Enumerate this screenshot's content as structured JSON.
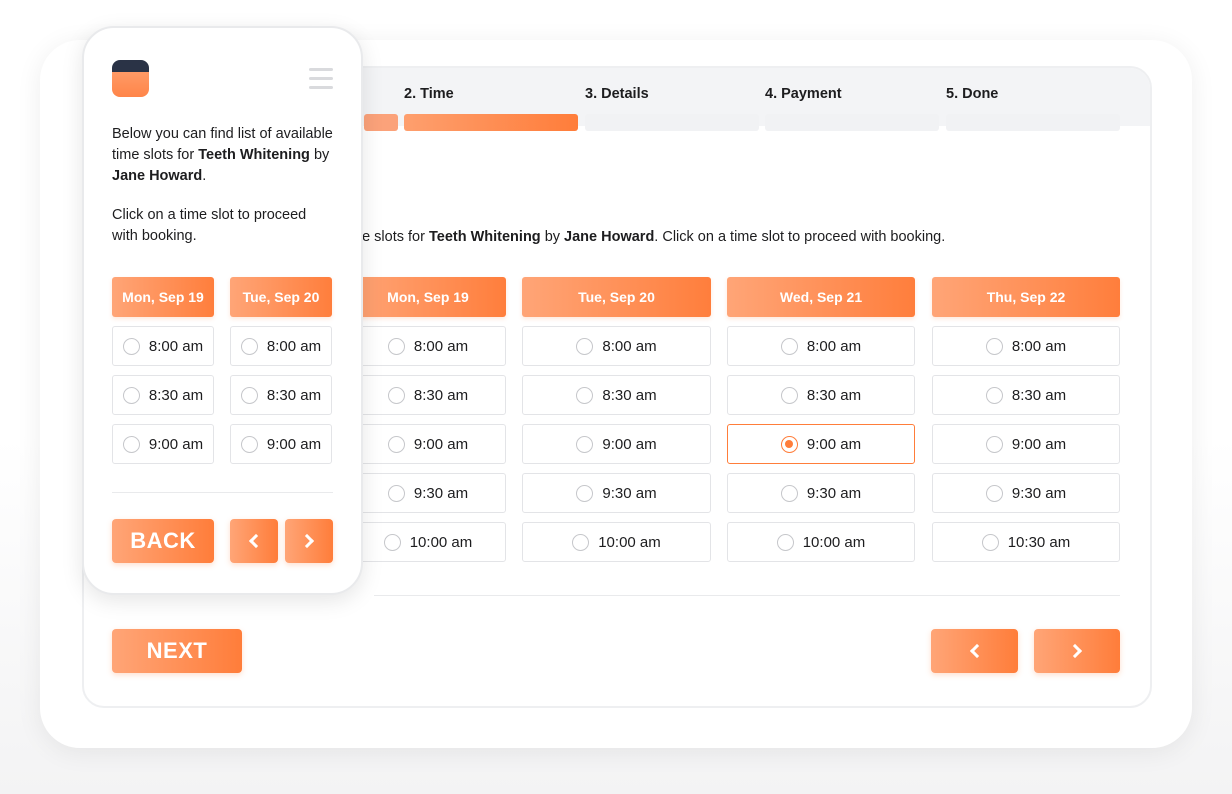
{
  "desktop": {
    "steps": [
      {
        "label": "2. Time",
        "state": "active"
      },
      {
        "label": "3. Details",
        "state": "pending"
      },
      {
        "label": "4. Payment",
        "state": "pending"
      },
      {
        "label": "5. Done",
        "state": "pending"
      }
    ],
    "intro": {
      "prefix": "me slots for ",
      "service": "Teeth Whitening",
      "by": " by ",
      "staff": "Jane Howard",
      "suffix": ". Click on a time slot to proceed with booking."
    },
    "days": [
      {
        "label": "Mon, Sep 19",
        "slots": [
          "8:00 am",
          "8:30 am",
          "9:00 am",
          "9:30 am",
          "10:00 am"
        ]
      },
      {
        "label": "Tue, Sep 20",
        "slots": [
          "8:00 am",
          "8:30 am",
          "9:00 am",
          "9:30 am",
          "10:00 am"
        ]
      },
      {
        "label": "Wed, Sep 21",
        "slots": [
          "8:00 am",
          "8:30 am",
          "9:00 am",
          "9:30 am",
          "10:00 am"
        ]
      },
      {
        "label": "Thu, Sep 22",
        "slots": [
          "8:00 am",
          "8:30 am",
          "9:00 am",
          "9:30 am",
          "10:30 am"
        ]
      }
    ],
    "selected_slot": "Wed, Sep 21 9:00 am",
    "next_label": "NEXT"
  },
  "mobile": {
    "intro": {
      "line1": "Below you can find list of available time slots for ",
      "service": "Teeth Whitening",
      "by": " by ",
      "staff": "Jane Howard",
      "end": "."
    },
    "instruction": "Click on a time slot to proceed with booking.",
    "days": [
      {
        "label": "Mon, Sep 19",
        "slots": [
          "8:00 am",
          "8:30 am",
          "9:00 am"
        ]
      },
      {
        "label": "Tue, Sep 20",
        "slots": [
          "8:00 am",
          "8:30 am",
          "9:00 am"
        ]
      }
    ],
    "back_label": "BACK"
  },
  "colors": {
    "accent": "#ff7d3a",
    "accent_light": "#ffa577",
    "border": "#e3e4e7",
    "logo_dark": "#2a3346"
  },
  "icons": [
    "chevron-left-icon",
    "chevron-right-icon",
    "hamburger-menu-icon",
    "app-logo-icon",
    "radio-icon"
  ]
}
